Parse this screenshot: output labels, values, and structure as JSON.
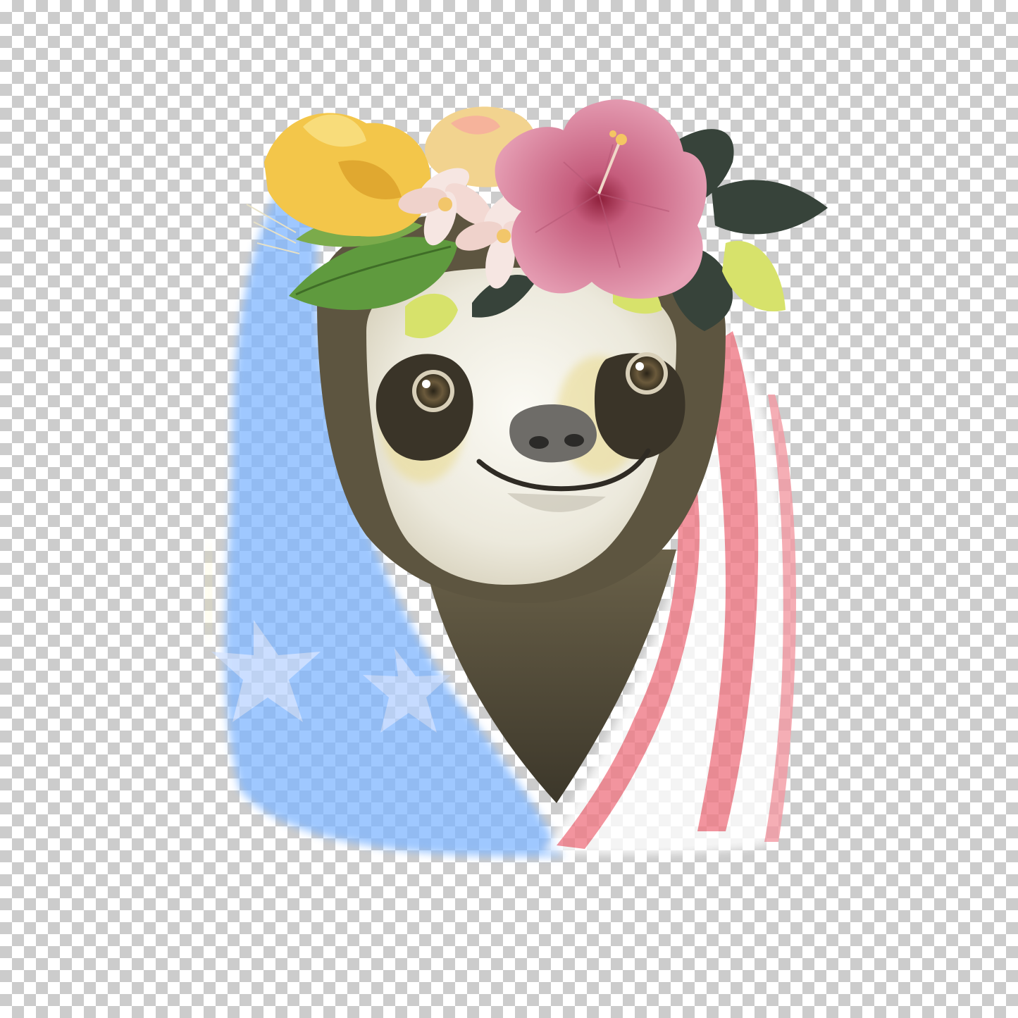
{
  "scene": {
    "subject": "sloth-icon",
    "background": "transparency-checkerboard-icon",
    "colors": {
      "checker_light": "#ffffff",
      "checker_dark": "#cccccc",
      "flag_blue": "#7fb6ff",
      "flag_red": "#f07a86",
      "fur_dark": "#4e4836",
      "fur_mid": "#7d7358",
      "face_light": "#f1efe6",
      "hibiscus": "#d9849e",
      "yellow_flower": "#f3c64a",
      "leaf_green": "#5f9a3e",
      "leaf_dark": "#37433a",
      "leaf_light": "#d7e26b",
      "frangipani": "#f6e6e2"
    }
  }
}
